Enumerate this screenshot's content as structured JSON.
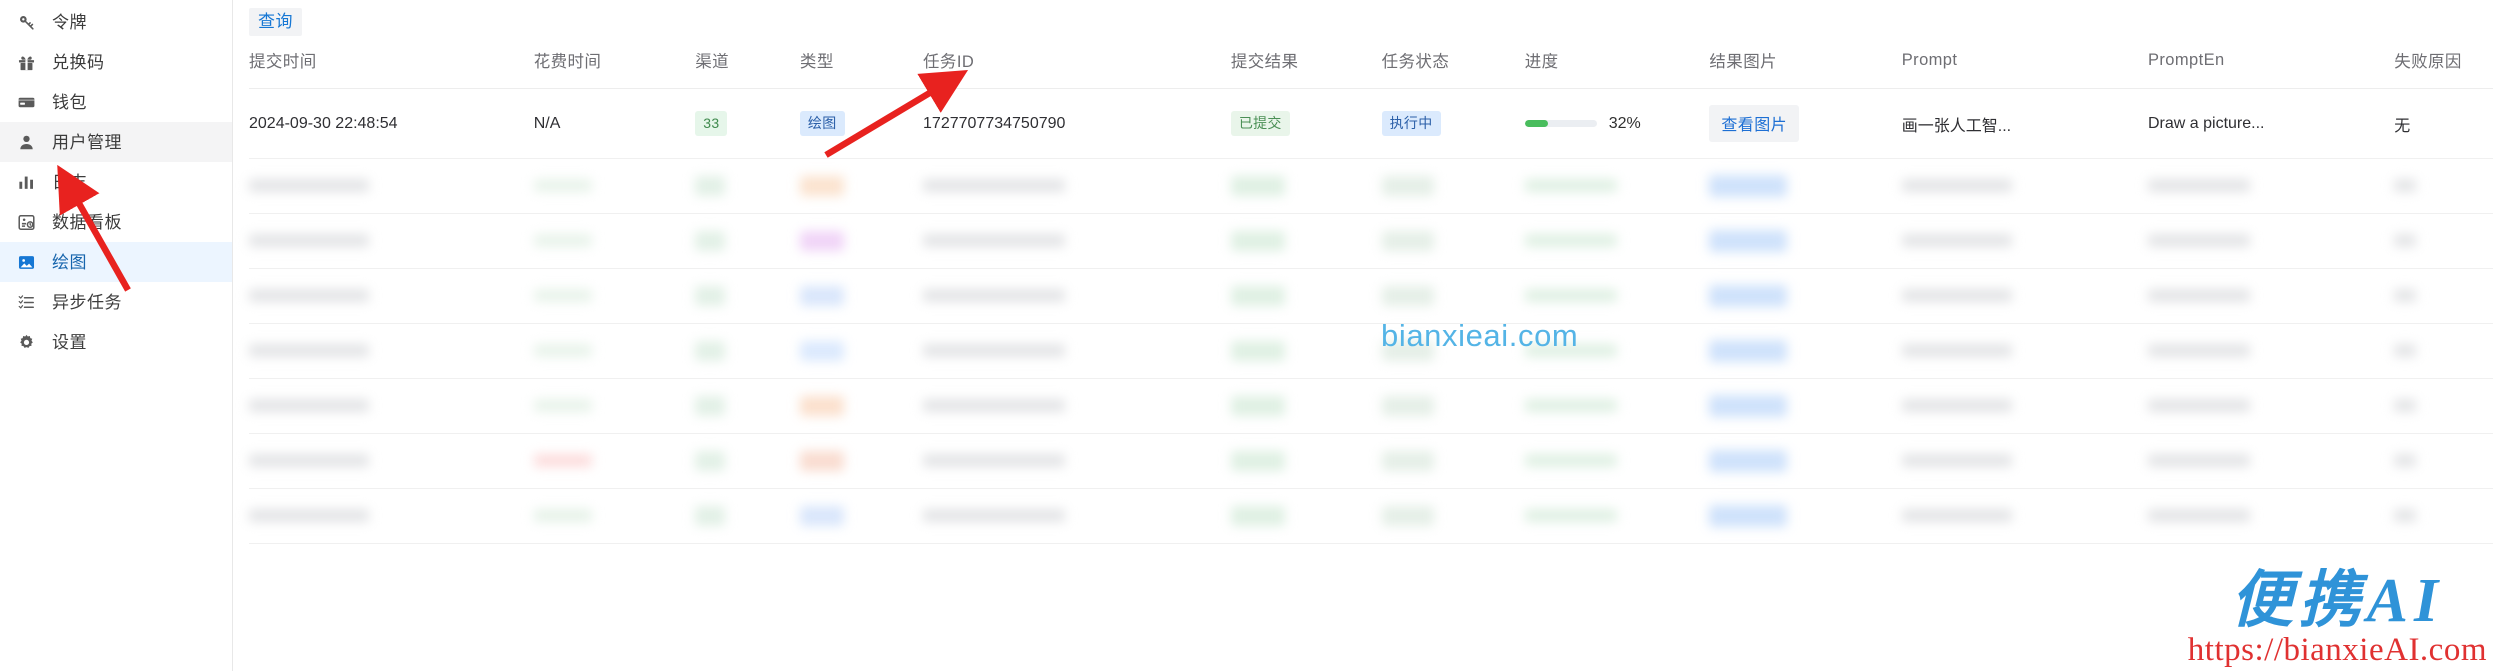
{
  "sidebar": {
    "items": [
      {
        "label": "令牌",
        "icon": "key-icon",
        "state": "normal"
      },
      {
        "label": "兑换码",
        "icon": "gift-icon",
        "state": "normal"
      },
      {
        "label": "钱包",
        "icon": "wallet-icon",
        "state": "normal"
      },
      {
        "label": "用户管理",
        "icon": "user-icon",
        "state": "hover"
      },
      {
        "label": "日志",
        "icon": "bar-chart-icon",
        "state": "normal"
      },
      {
        "label": "数据看板",
        "icon": "dashboard-icon",
        "state": "normal"
      },
      {
        "label": "绘图",
        "icon": "image-icon",
        "state": "active"
      },
      {
        "label": "异步任务",
        "icon": "task-list-icon",
        "state": "normal"
      },
      {
        "label": "设置",
        "icon": "gear-icon",
        "state": "normal"
      }
    ]
  },
  "toolbar": {
    "query_label": "查询"
  },
  "table": {
    "columns": [
      "提交时间",
      "花费时间",
      "渠道",
      "类型",
      "任务ID",
      "提交结果",
      "任务状态",
      "进度",
      "结果图片",
      "Prompt",
      "PromptEn",
      "失败原因"
    ],
    "rows": [
      {
        "submit_time": "2024-09-30 22:48:54",
        "cost_time": "N/A",
        "channel": "33",
        "type": "绘图",
        "task_id": "1727707734750790",
        "submit_result": "已提交",
        "task_status": "执行中",
        "progress_pct": 32,
        "progress_label": "32%",
        "image_action": "查看图片",
        "prompt": "画一张人工智...",
        "prompt_en": "Draw a picture...",
        "fail_reason": "无"
      }
    ],
    "blurred_row_count": 7
  },
  "watermarks": {
    "center": "bianxieai.com",
    "brand_cn": "便携AI",
    "brand_url": "https://bianxieAI.com"
  },
  "colors": {
    "accent_blue": "#1677d4",
    "active_nav_bg": "#ecf5ff",
    "progress_green": "#49bd5d",
    "tag_green_bg": "#e9f5ea",
    "tag_blue_bg": "#dbeafd",
    "annotation_red": "#e8221f",
    "center_watermark": "#54b4e6",
    "brand_blue": "#2f93d8",
    "brand_red": "#e03131"
  }
}
